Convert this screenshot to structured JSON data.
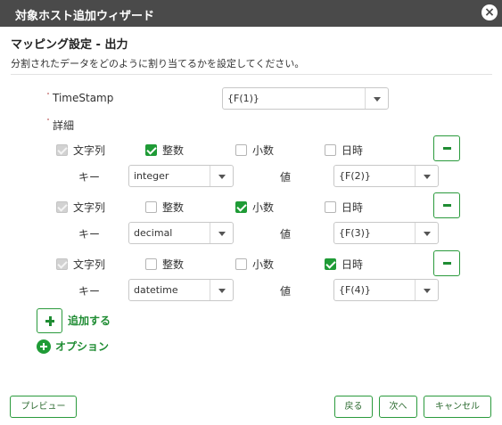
{
  "window": {
    "title": "対象ホスト追加ウィザード"
  },
  "section": {
    "title": "マッピング設定 - 出力",
    "description": "分割されたデータをどのように割り当てるかを設定してください。"
  },
  "timestamp": {
    "label": "TimeStamp",
    "value": "{F(1)}"
  },
  "details_label": "詳細",
  "rows": [
    {
      "types": {
        "string": "文字列",
        "integer": "整数",
        "decimal": "小数",
        "datetime": "日時"
      },
      "checked": {
        "string": true,
        "integer": true,
        "decimal": false,
        "datetime": false
      },
      "key_label": "キー",
      "key_value": "integer",
      "value_label": "値",
      "value_value": "{F(2)}"
    },
    {
      "types": {
        "string": "文字列",
        "integer": "整数",
        "decimal": "小数",
        "datetime": "日時"
      },
      "checked": {
        "string": true,
        "integer": false,
        "decimal": true,
        "datetime": false
      },
      "key_label": "キー",
      "key_value": "decimal",
      "value_label": "値",
      "value_value": "{F(3)}"
    },
    {
      "types": {
        "string": "文字列",
        "integer": "整数",
        "decimal": "小数",
        "datetime": "日時"
      },
      "checked": {
        "string": true,
        "integer": false,
        "decimal": false,
        "datetime": true
      },
      "key_label": "キー",
      "key_value": "datetime",
      "value_label": "値",
      "value_value": "{F(4)}"
    }
  ],
  "add_label": "追加する",
  "option_label": "オプション",
  "footer": {
    "preview": "プレビュー",
    "back": "戻る",
    "next": "次へ",
    "cancel": "キャンセル"
  },
  "colors": {
    "titlebar": "#4a4a4a",
    "accent": "#1f9b36",
    "accent_text": "#1f8c33",
    "disabled": "#d2d2d2"
  },
  "icons": {
    "close": "close-icon",
    "remove": "minus-icon",
    "add": "plus-icon",
    "option": "plus-circle-icon",
    "dropdown": "chevron-down-icon",
    "check": "check-icon"
  }
}
